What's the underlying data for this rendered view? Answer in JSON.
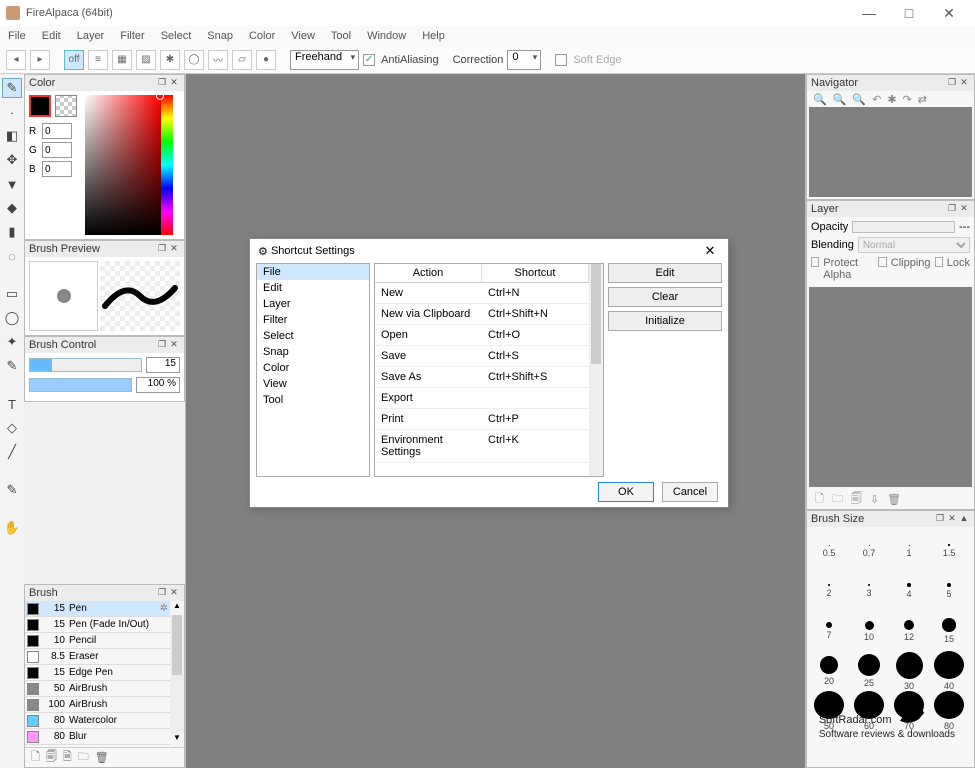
{
  "window": {
    "title": "FireAlpaca (64bit)"
  },
  "menu": [
    "File",
    "Edit",
    "Layer",
    "Filter",
    "Select",
    "Snap",
    "Color",
    "View",
    "Tool",
    "Window",
    "Help"
  ],
  "toolbar": {
    "mode": "Freehand",
    "antialias_label": "AntiAliasing",
    "correction_label": "Correction",
    "correction_value": "0",
    "softedge_label": "Soft Edge"
  },
  "panels": {
    "color": {
      "title": "Color",
      "r_label": "R",
      "r": "0",
      "g_label": "G",
      "g": "0",
      "b_label": "B",
      "b": "0"
    },
    "brush_preview": {
      "title": "Brush Preview"
    },
    "brush_control": {
      "title": "Brush Control",
      "size": "15",
      "opacity": "100 %"
    },
    "brush": {
      "title": "Brush",
      "items": [
        {
          "size": "15",
          "name": "Pen",
          "color": "#000",
          "sel": true
        },
        {
          "size": "15",
          "name": "Pen (Fade In/Out)",
          "color": "#000"
        },
        {
          "size": "10",
          "name": "Pencil",
          "color": "#000"
        },
        {
          "size": "8.5",
          "name": "Eraser",
          "color": "#fff"
        },
        {
          "size": "15",
          "name": "Edge Pen",
          "color": "#000"
        },
        {
          "size": "50",
          "name": "AirBrush",
          "color": "#888"
        },
        {
          "size": "100",
          "name": "AirBrush",
          "color": "#888"
        },
        {
          "size": "80",
          "name": "Watercolor",
          "color": "#6cf"
        },
        {
          "size": "80",
          "name": "Blur",
          "color": "#f9f"
        }
      ]
    },
    "navigator": {
      "title": "Navigator"
    },
    "layer": {
      "title": "Layer",
      "opacity_label": "Opacity",
      "opacity_suffix": "---",
      "blending_label": "Blending",
      "blending_value": "Normal",
      "protect_label": "Protect Alpha",
      "clipping_label": "Clipping",
      "lock_label": "Lock"
    },
    "brush_size": {
      "title": "Brush Size",
      "sizes": [
        0.5,
        0.7,
        1,
        1.5,
        2,
        3,
        4,
        5,
        7,
        10,
        12,
        15,
        20,
        25,
        30,
        40,
        50,
        60,
        70,
        80
      ]
    }
  },
  "dialog": {
    "title": "Shortcut Settings",
    "categories": [
      "File",
      "Edit",
      "Layer",
      "Filter",
      "Select",
      "Snap",
      "Color",
      "View",
      "Tool"
    ],
    "head_action": "Action",
    "head_shortcut": "Shortcut",
    "rows": [
      {
        "action": "New",
        "shortcut": "Ctrl+N"
      },
      {
        "action": "New via Clipboard",
        "shortcut": "Ctrl+Shift+N"
      },
      {
        "action": "Open",
        "shortcut": "Ctrl+O"
      },
      {
        "action": "Save",
        "shortcut": "Ctrl+S"
      },
      {
        "action": "Save As",
        "shortcut": "Ctrl+Shift+S"
      },
      {
        "action": "Export",
        "shortcut": ""
      },
      {
        "action": "Print",
        "shortcut": "Ctrl+P"
      },
      {
        "action": "Environment Settings",
        "shortcut": "Ctrl+K"
      }
    ],
    "btn_edit": "Edit",
    "btn_clear": "Clear",
    "btn_init": "Initialize",
    "btn_ok": "OK",
    "btn_cancel": "Cancel"
  },
  "watermark": {
    "brand": "SoftRadar.com",
    "sub": "Software reviews & downloads"
  }
}
